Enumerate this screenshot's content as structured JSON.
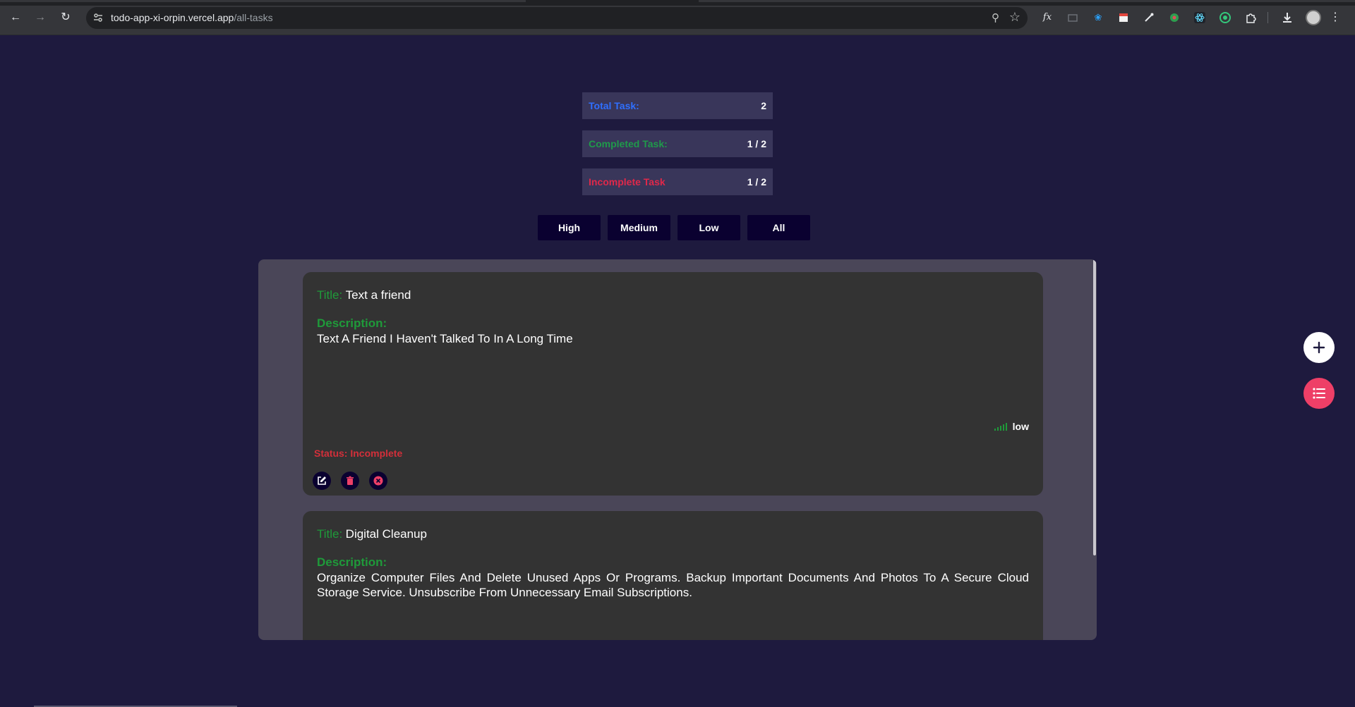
{
  "browser": {
    "url_host": "todo-app-xi-orpin.vercel.app",
    "url_path": "/all-tasks"
  },
  "stats": {
    "total_label": "Total Task:",
    "total_value": "2",
    "completed_label": "Completed Task:",
    "completed_value": "1 / 2",
    "incomplete_label": "Incomplete Task",
    "incomplete_value": "1 / 2"
  },
  "filters": [
    "High",
    "Medium",
    "Low",
    "All"
  ],
  "tasks": [
    {
      "title_label": "Title:",
      "title": "Text a friend",
      "description_label": "Description:",
      "description": "Text A Friend I Haven't Talked To In A Long Time",
      "priority": "low",
      "status": "Status: Incomplete"
    },
    {
      "title_label": "Title:",
      "title": "Digital Cleanup",
      "description_label": "Description:",
      "description": "Organize Computer Files And Delete Unused Apps Or Programs. Backup Important Documents And Photos To A Secure Cloud Storage Service. Unsubscribe From Unnecessary Email Subscriptions."
    }
  ],
  "colors": {
    "background": "#1e1a3e",
    "total": "#2f6fff",
    "completed": "#1f9a4a",
    "incomplete": "#e0284a",
    "fab_list": "#ee3f67"
  }
}
